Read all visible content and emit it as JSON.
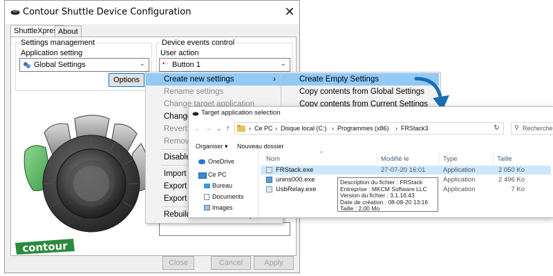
{
  "window": {
    "title": "Contour Shuttle Device Configuration",
    "close": "✕"
  },
  "tabs": [
    {
      "label": "ShuttleXpress"
    },
    {
      "label": "About"
    }
  ],
  "settings_management": {
    "group_label": "Settings management",
    "app_setting_label": "Application setting",
    "app_setting_value": "Global Settings",
    "options_button": "Options"
  },
  "device_events": {
    "group_label": "Device events control",
    "user_action_label": "User action",
    "user_action_value": "Button 1"
  },
  "bottom_buttons": {
    "close": "Close",
    "cancel": "Cancel",
    "apply": "Apply"
  },
  "logo": {
    "text": "contour"
  },
  "context_menu": {
    "items": [
      {
        "label": "Create new settings",
        "state": "highlighted",
        "arrow": "›"
      },
      {
        "label": "Rename settings",
        "state": "disabled"
      },
      {
        "label": "Change target application",
        "state": "disabled"
      },
      {
        "label": "Change s",
        "state": "normal"
      },
      {
        "label": "Revert to",
        "state": "disabled"
      },
      {
        "label": "Remove",
        "state": "disabled"
      },
      {
        "label": "Disable s",
        "state": "normal"
      },
      {
        "label": "Import s",
        "state": "normal"
      },
      {
        "label": "Export s",
        "state": "normal"
      },
      {
        "label": "Export s",
        "state": "normal"
      },
      {
        "label": "Rebuild the whole settings file",
        "state": "normal"
      }
    ]
  },
  "submenu": {
    "items": [
      {
        "label": "Create Empty Settings",
        "state": "highlighted"
      },
      {
        "label": "Copy contents from Global Settings",
        "state": "normal"
      },
      {
        "label": "Copy contents from Current Settings",
        "state": "normal"
      }
    ]
  },
  "file_dialog": {
    "title": "Target application selection",
    "breadcrumb": [
      "Ce PC",
      "Disque local (C:)",
      "Programmes (x86)",
      "FRStack3"
    ],
    "search_placeholder": "Rechercher",
    "organize": "Organiser",
    "new_folder": "Nouveau dossier",
    "columns": {
      "name": "Nom",
      "modified": "Modifié le",
      "type": "Type",
      "size": "Taille"
    },
    "nav_items": [
      {
        "label": "OneDrive",
        "icon": "cloud-icon"
      },
      {
        "label": "Ce PC",
        "icon": "computer-icon"
      },
      {
        "label": "Bureau",
        "icon": "desktop-icon"
      },
      {
        "label": "Documents",
        "icon": "documents-icon"
      },
      {
        "label": "Images",
        "icon": "images-icon"
      }
    ],
    "files": [
      {
        "name": "FRStack.exe",
        "modified": "27-07-20 16:01",
        "type": "Application",
        "size": "2 050 Ko",
        "selected": true
      },
      {
        "name": "unins000.exe",
        "modified": "",
        "type": "Application",
        "size": "2 496 Ko",
        "selected": false
      },
      {
        "name": "UsbRelay.exe",
        "modified": "",
        "type": "Application",
        "size": "7 Ko",
        "selected": false
      }
    ],
    "tooltip": [
      "Description du fichier : FRStack",
      "Entreprise : MKCM Software LLC",
      "Version du fichier : 3.1.16.43",
      "Date de création : 08-08-20 13:16",
      "Taille : 2,00 Mo"
    ]
  },
  "colors": {
    "menu_highlight": "#91c9f7",
    "arrow": "#1a6fb0",
    "green_button": "#5db76a",
    "logo_green": "#2a8a3e"
  }
}
